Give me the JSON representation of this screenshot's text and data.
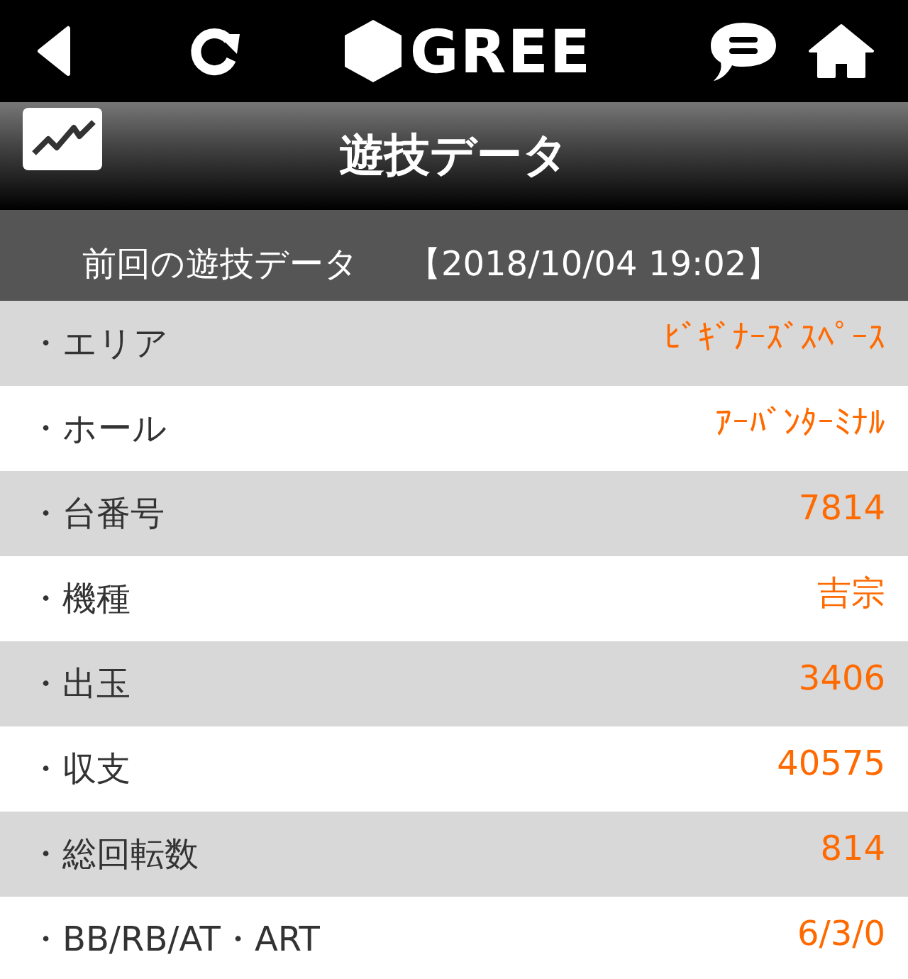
{
  "nav_bar": {
    "logo": "GREE"
  },
  "title_bar": {
    "title": "遊技データ"
  },
  "section": {
    "label": "前回の遊技データ",
    "timestamp": "【2018/10/04 19:02】"
  },
  "rows": [
    {
      "bullet": "・",
      "label": "エリア",
      "value": "ﾋﾞｷﾞﾅｰｽﾞｽﾍﾟｰｽ"
    },
    {
      "bullet": "・",
      "label": "ホール",
      "value": "ｱｰﾊﾞﾝﾀｰﾐﾅﾙ"
    },
    {
      "bullet": "・",
      "label": "台番号",
      "value": "7814"
    },
    {
      "bullet": "・",
      "label": "機種",
      "value": "吉宗"
    },
    {
      "bullet": "・",
      "label": "出玉",
      "value": "3406"
    },
    {
      "bullet": "・",
      "label": "収支",
      "value": "40575"
    },
    {
      "bullet": "・",
      "label": "総回転数",
      "value": "814"
    },
    {
      "bullet": "・",
      "label": "BB/RB/AT・ART",
      "value": "6/3/0"
    }
  ]
}
